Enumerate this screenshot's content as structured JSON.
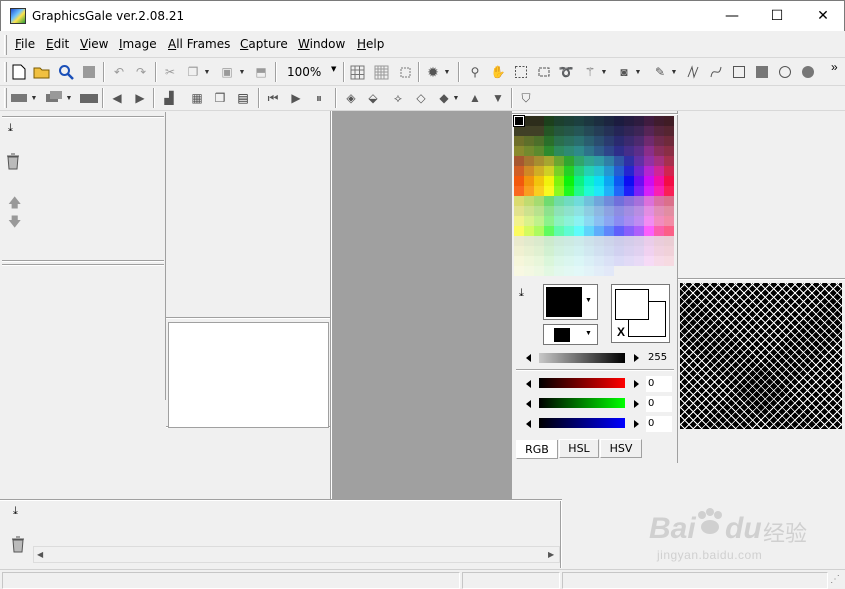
{
  "window": {
    "title": "GraphicsGale ver.2.08.21",
    "minimize_glyph": "—",
    "maximize_glyph": "☐",
    "close_glyph": "✕"
  },
  "menu": [
    {
      "label": "File",
      "u": "F",
      "rest": "ile"
    },
    {
      "label": "Edit",
      "u": "E",
      "rest": "dit"
    },
    {
      "label": "View",
      "u": "V",
      "rest": "iew"
    },
    {
      "label": "Image",
      "u": "I",
      "rest": "mage"
    },
    {
      "label": "All Frames",
      "u": "A",
      "rest": "ll Frames"
    },
    {
      "label": "Capture",
      "u": "C",
      "rest": "apture"
    },
    {
      "label": "Window",
      "u": "W",
      "rest": "indow"
    },
    {
      "label": "Help",
      "u": "H",
      "rest": "elp"
    }
  ],
  "toolbar": {
    "zoom_value": "100%",
    "overflow_glyph": "»"
  },
  "color_panel": {
    "alpha_value": "255",
    "red_value": "0",
    "green_value": "0",
    "blue_value": "0",
    "bg_marker": "X",
    "tabs": [
      "RGB",
      "HSL",
      "HSV"
    ],
    "active_tab": "RGB"
  },
  "colors": {
    "title_bg": "#ffffff",
    "ui_bg": "#f0f0f0",
    "canvas_bg": "#a0a0a0",
    "foreground_color": "#000000",
    "background_color": "#ffffff"
  },
  "watermark": {
    "brand": "Bai",
    "brand_tail": "du",
    "cn": "经验",
    "url": "jingyan.baidu.com"
  }
}
